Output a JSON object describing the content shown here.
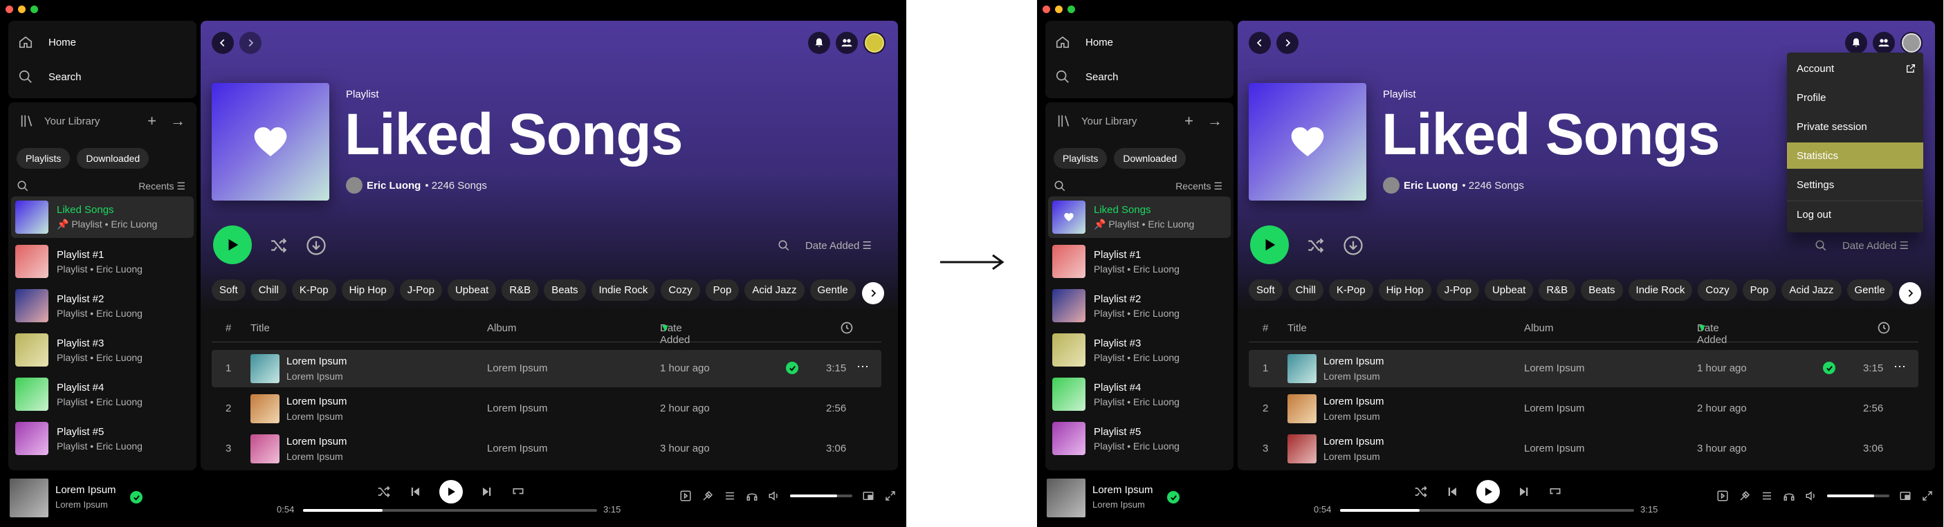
{
  "nav": {
    "home": "Home",
    "search": "Search"
  },
  "library": {
    "title": "Your Library",
    "add": "+",
    "expand": "→",
    "filters": [
      "Playlists",
      "Downloaded"
    ],
    "sort_label": "Recents",
    "items": [
      {
        "name": "Liked Songs",
        "sub": "Playlist • Eric Luong"
      },
      {
        "name": "Playlist #1",
        "sub": "Playlist • Eric Luong"
      },
      {
        "name": "Playlist #2",
        "sub": "Playlist • Eric Luong"
      },
      {
        "name": "Playlist #3",
        "sub": "Playlist • Eric Luong"
      },
      {
        "name": "Playlist #4",
        "sub": "Playlist • Eric Luong"
      },
      {
        "name": "Playlist #5",
        "sub": "Playlist • Eric Luong"
      }
    ]
  },
  "hero": {
    "type": "Playlist",
    "title": "Liked Songs",
    "owner": "Eric Luong",
    "song_count": "• 2246 Songs"
  },
  "sort": {
    "label": "Date Added"
  },
  "tags": [
    "Soft",
    "Chill",
    "K-Pop",
    "Hip Hop",
    "J-Pop",
    "Upbeat",
    "R&B",
    "Beats",
    "Indie Rock",
    "Cozy",
    "Pop",
    "Acid Jazz",
    "Gentle"
  ],
  "table": {
    "headers": {
      "num": "#",
      "title": "Title",
      "album": "Album",
      "date": "Date Added"
    },
    "rows": [
      {
        "num": "1",
        "title": "Lorem Ipsum",
        "artist": "Lorem Ipsum",
        "album": "Lorem Ipsum",
        "date": "1 hour ago",
        "duration": "3:15"
      },
      {
        "num": "2",
        "title": "Lorem Ipsum",
        "artist": "Lorem Ipsum",
        "album": "Lorem Ipsum",
        "date": "2 hour ago",
        "duration": "2:56"
      },
      {
        "num": "3",
        "title": "Lorem Ipsum",
        "artist": "Lorem Ipsum",
        "album": "Lorem Ipsum",
        "date": "3 hour ago",
        "duration": "3:06"
      }
    ]
  },
  "player": {
    "title": "Lorem Ipsum",
    "artist": "Lorem Ipsum",
    "elapsed": "0:54",
    "total": "3:15",
    "progress_percent": 27,
    "volume_percent": 75
  },
  "menu": {
    "items": [
      "Account",
      "Profile",
      "Private session",
      "Statistics",
      "Settings",
      "Log out"
    ],
    "selected": "Statistics"
  },
  "colors": {
    "accent_green": "#1ed760",
    "menu_highlight": "#a7a54a",
    "avatar_yellow": "#d4c63c"
  }
}
